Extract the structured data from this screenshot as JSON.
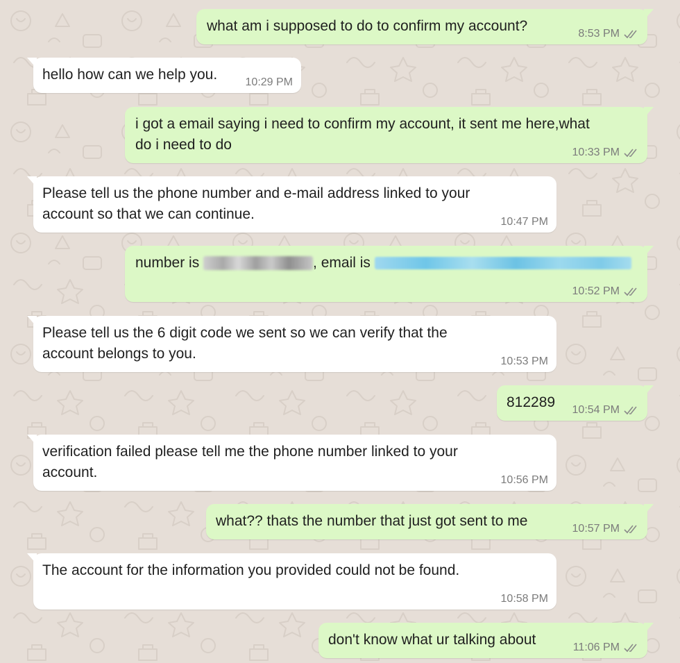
{
  "conversation": {
    "messages": [
      {
        "direction": "outgoing",
        "text": "what am i supposed to do to confirm my account?",
        "time": "8:53 PM"
      },
      {
        "direction": "incoming",
        "text": "hello how can we help you.",
        "time": "10:29 PM"
      },
      {
        "direction": "outgoing",
        "lines": [
          "i got a email saying i need to confirm my account, it sent me here,what",
          "do i need to do"
        ],
        "time": "10:33 PM"
      },
      {
        "direction": "incoming",
        "lines": [
          "Please tell us the phone number and e-mail address linked to your",
          "account so that we can continue."
        ],
        "time": "10:47 PM"
      },
      {
        "direction": "outgoing",
        "number_label": "number is",
        "comma": ",",
        "email_label": "email is",
        "time": "10:52 PM"
      },
      {
        "direction": "incoming",
        "lines": [
          "Please tell us the 6 digit code we sent so we can verify that the",
          "account belongs to you."
        ],
        "time": "10:53 PM"
      },
      {
        "direction": "outgoing",
        "text": "812289",
        "time": "10:54 PM"
      },
      {
        "direction": "incoming",
        "lines": [
          "verification failed please tell me the phone number linked to your",
          "account."
        ],
        "time": "10:56 PM"
      },
      {
        "direction": "outgoing",
        "text": "what?? thats the number that just got sent to me",
        "time": "10:57 PM"
      },
      {
        "direction": "incoming",
        "text": "The account for the information you provided could not be found.",
        "time": "10:58 PM"
      },
      {
        "direction": "outgoing",
        "text": "don't know what ur talking about",
        "time": "11:06 PM"
      }
    ]
  },
  "colors": {
    "wallpaper": "#e6ded7",
    "incoming_bubble": "#ffffff",
    "outgoing_bubble": "#dcf8c6",
    "text": "#1f1f1f",
    "timestamp": "#7b7b7b",
    "read_ticks": "#8a8a8a"
  },
  "icons": {
    "read_receipt": "double-check-icon",
    "redaction_phone": "blurred-phone-number",
    "redaction_email": "blurred-email-address"
  }
}
